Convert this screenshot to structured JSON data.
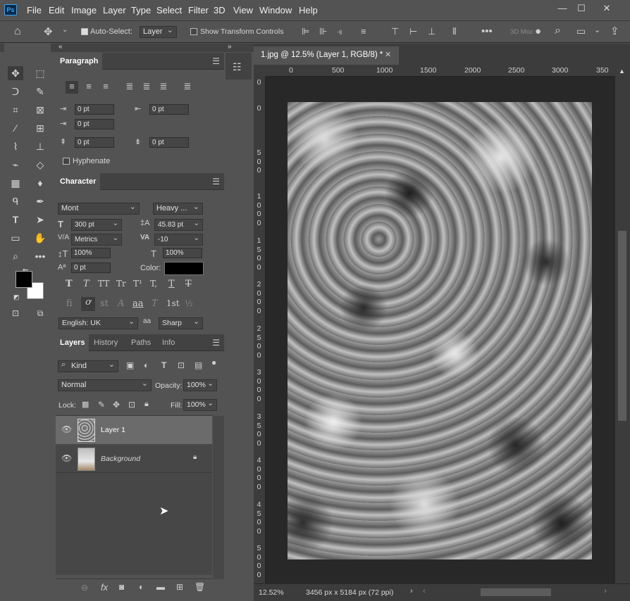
{
  "app": {
    "logo": "Ps"
  },
  "menu": [
    "File",
    "Edit",
    "Image",
    "Layer",
    "Type",
    "Select",
    "Filter",
    "3D",
    "View",
    "Window",
    "Help"
  ],
  "options": {
    "auto_select_label": "Auto-Select:",
    "auto_select_target": "Layer",
    "show_transform_label": "Show Transform Controls",
    "mode_3d_label": "3D Moc"
  },
  "paragraph": {
    "title": "Paragraph",
    "indent_left": "0 pt",
    "indent_right": "0 pt",
    "indent_first": "0 pt",
    "space_before": "0 pt",
    "space_after": "0 pt",
    "hyphenate": "Hyphenate"
  },
  "character": {
    "title": "Character",
    "font_family": "Mont",
    "font_style": "Heavy ...",
    "font_size": "300 pt",
    "leading": "45.83 pt",
    "kerning": "Metrics",
    "tracking": "-10",
    "vscale": "100%",
    "hscale": "100%",
    "baseline": "0 pt",
    "color_label": "Color:",
    "color": "#000000",
    "language": "English: UK",
    "antialias_label": "aa",
    "antialias": "Sharp",
    "style_buttons": [
      "T",
      "T",
      "TT",
      "Tr",
      "T¹",
      "T,",
      "T",
      "T"
    ],
    "ot_buttons": [
      "fi",
      "ơ",
      "st",
      "A",
      "aa",
      "T",
      "1st",
      "½"
    ]
  },
  "layers": {
    "tabs": [
      "Layers",
      "History",
      "Paths",
      "Info"
    ],
    "filter": "Kind",
    "blend": "Normal",
    "opacity_label": "Opacity:",
    "opacity": "100%",
    "lock_label": "Lock:",
    "fill_label": "Fill:",
    "fill": "100%",
    "items": [
      {
        "name": "Layer 1"
      },
      {
        "name": "Background"
      }
    ]
  },
  "document": {
    "tab_title": "1.jpg @ 12.5% (Layer 1, RGB/8) *",
    "zoom": "12.52%",
    "info": "3456 px x 5184 px (72 ppi)",
    "ruler_h": [
      "0",
      "500",
      "1000",
      "1500",
      "2000",
      "2500",
      "3000",
      "350"
    ],
    "ruler_v": [
      "0",
      "0",
      "500",
      "1000",
      "1500",
      "2000",
      "2500",
      "3000",
      "3500",
      "4000",
      "4500",
      "5000"
    ]
  },
  "colors": {
    "foreground": "#000000",
    "background": "#ffffff"
  }
}
